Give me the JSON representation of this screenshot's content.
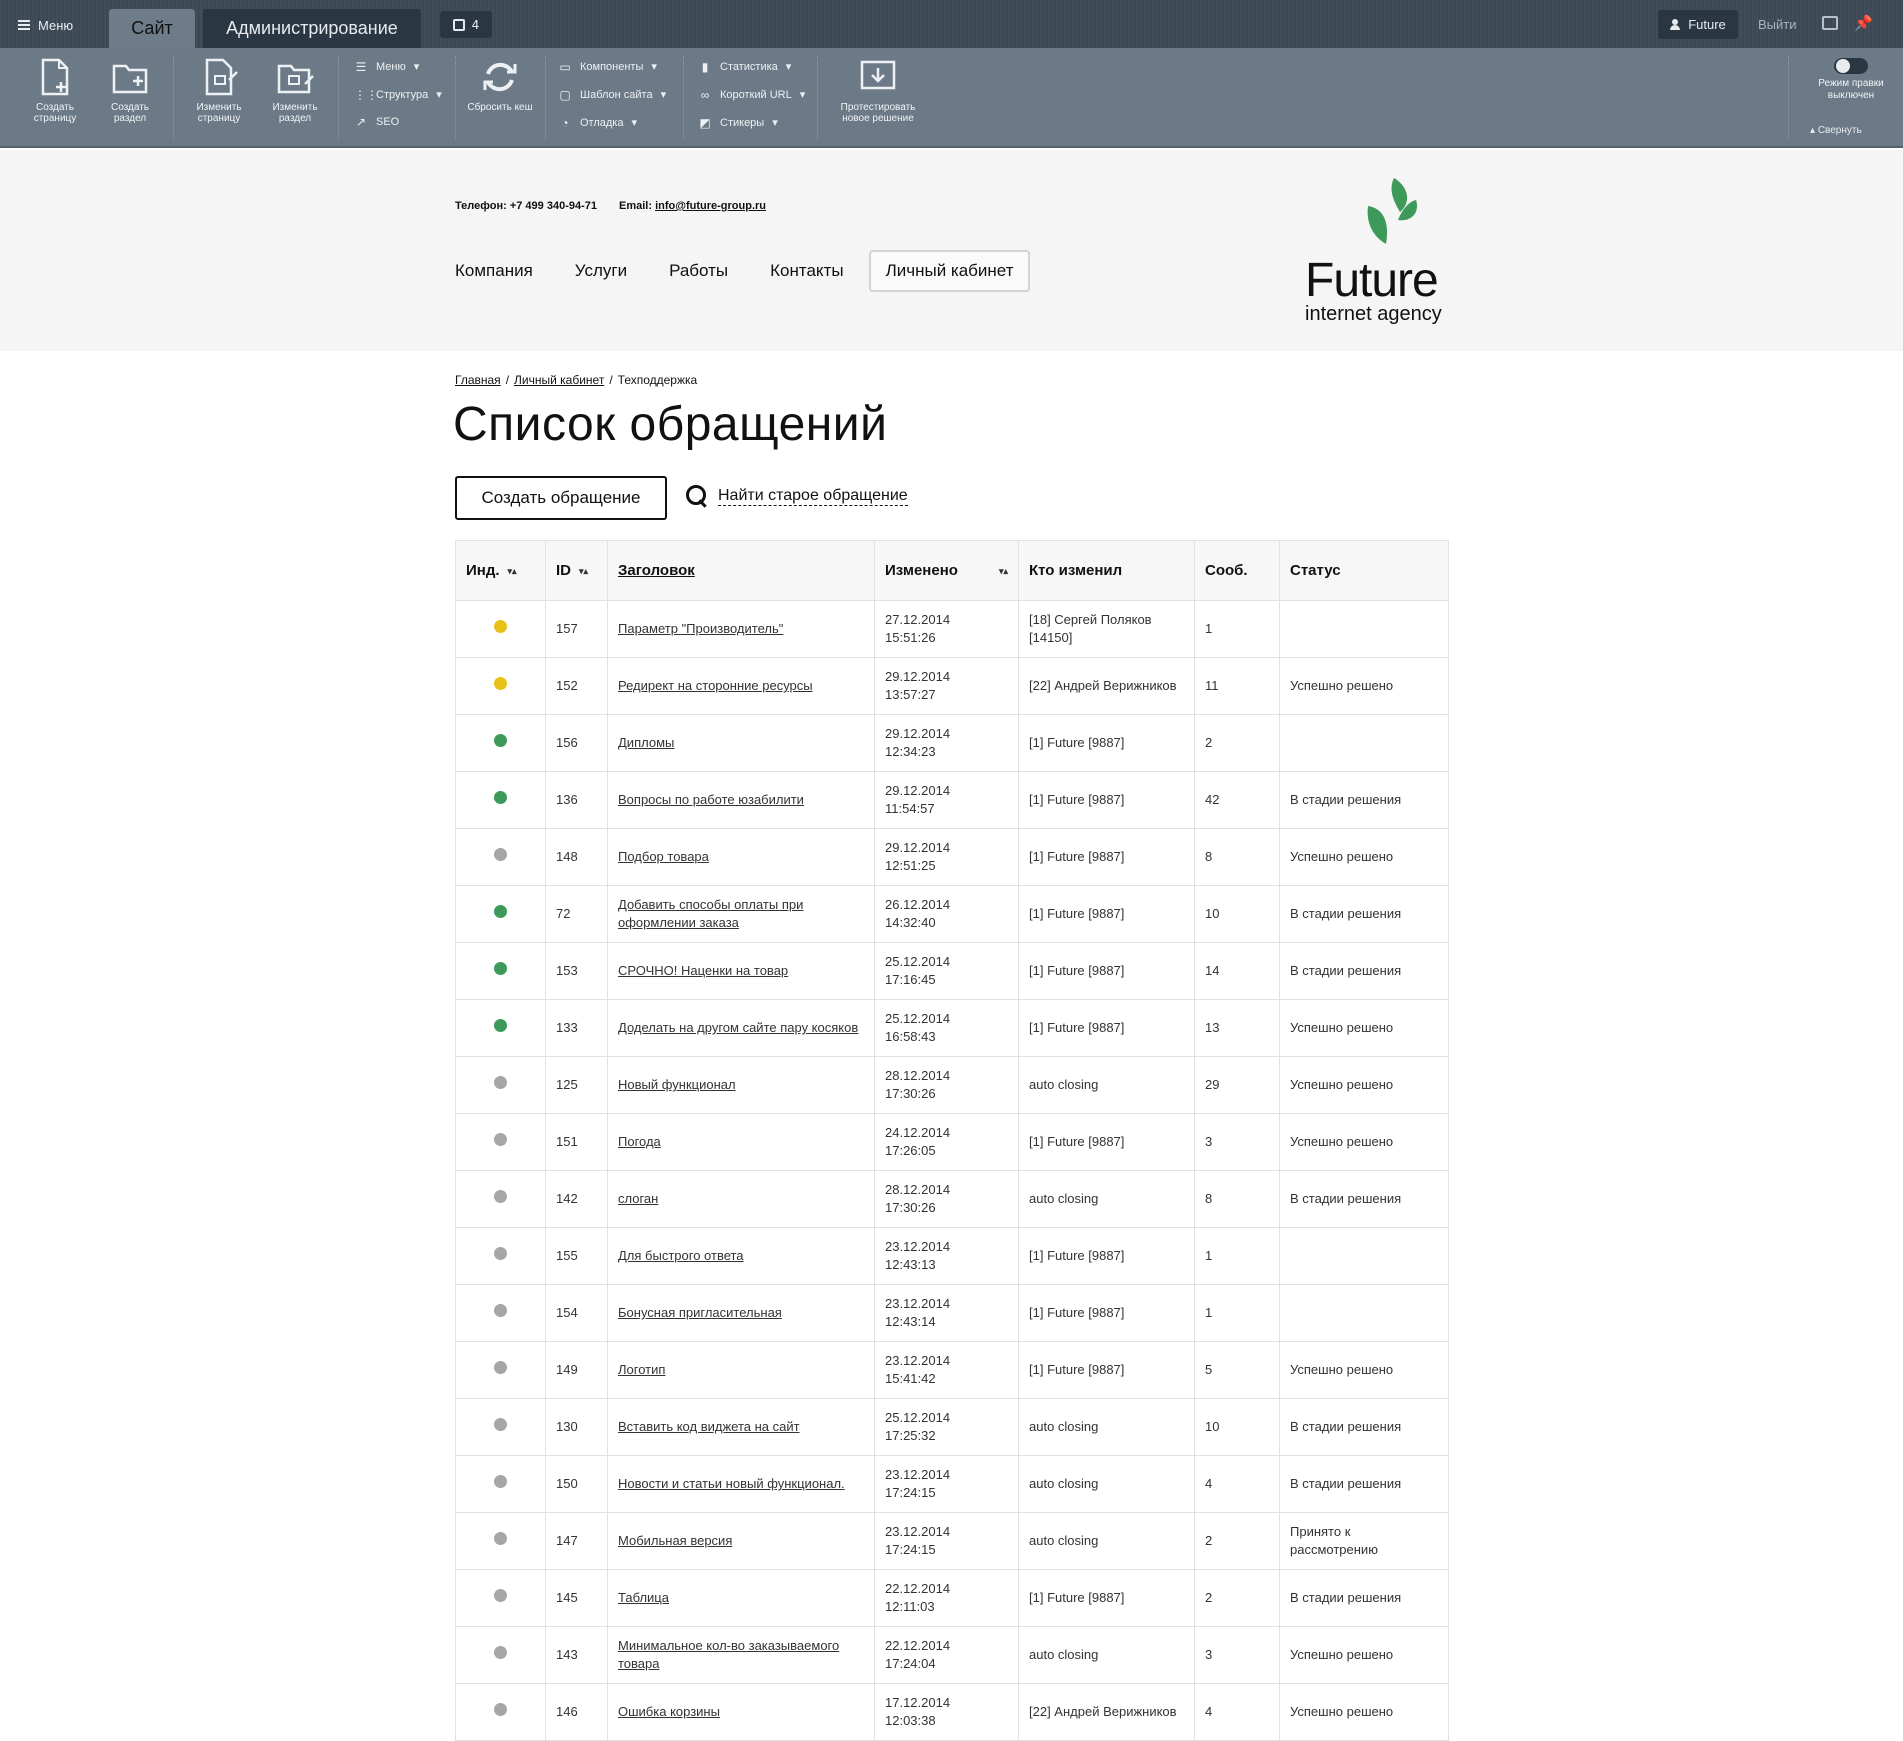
{
  "admin": {
    "menu_label": "Меню",
    "tab_site": "Сайт",
    "tab_admin": "Администрирование",
    "notifications_count": "4",
    "user_label": "Future",
    "logout_label": "Выйти",
    "tools": {
      "create_page": "Создать страницу",
      "create_section": "Создать раздел",
      "edit_page": "Изменить страницу",
      "edit_section": "Изменить раздел",
      "menu": "Меню",
      "structure": "Структура",
      "seo": "SEO",
      "reset_cache": "Сбросить кеш",
      "components": "Компоненты",
      "site_template": "Шаблон сайта",
      "debug": "Отладка",
      "statistics": "Статистика",
      "short_url": "Короткий URL",
      "stickers": "Стикеры",
      "test_solution": "Протестировать новое решение",
      "edit_mode": "Режим правки выключен",
      "collapse": "Свернуть"
    }
  },
  "header": {
    "phone_label": "Телефон:",
    "phone": "+7 499 340-94-71",
    "email_label": "Email:",
    "email": "info@future-group.ru",
    "nav": [
      "Компания",
      "Услуги",
      "Работы",
      "Контакты"
    ],
    "nav_cabinet": "Личный кабинет",
    "logo_title": "Future",
    "logo_subtitle": "internet agency"
  },
  "breadcrumbs": {
    "home": "Главная",
    "cabinet": "Личный кабинет",
    "current": "Техподдержка"
  },
  "page_title": "Список обращений",
  "create_button": "Создать обращение",
  "find_link": "Найти старое обращение",
  "colors": {
    "yellow": "#e8c21a",
    "green": "#3e9a5a",
    "grey": "#a6a6a6"
  },
  "table": {
    "headers": {
      "ind": "Инд.",
      "id": "ID",
      "title": "Заголовок",
      "changed": "Изменено",
      "who": "Кто изменил",
      "msgs": "Сооб.",
      "status": "Статус"
    },
    "rows": [
      {
        "ind": "yellow",
        "id": "157",
        "title": "Параметр \"Производитель\"",
        "date": "27.12.2014",
        "time": "15:51:26",
        "who": "[18] Сергей Поляков [14150]",
        "msgs": "1",
        "status": ""
      },
      {
        "ind": "yellow",
        "id": "152",
        "title": "Редирект на сторонние ресурсы",
        "date": "29.12.2014",
        "time": "13:57:27",
        "who": "[22] Андрей Верижников",
        "msgs": "11",
        "status": "Успешно решено"
      },
      {
        "ind": "green",
        "id": "156",
        "title": "Дипломы",
        "date": "29.12.2014",
        "time": "12:34:23",
        "who": "[1] Future [9887]",
        "msgs": "2",
        "status": ""
      },
      {
        "ind": "green",
        "id": "136",
        "title": "Вопросы по работе юзабилити",
        "date": "29.12.2014",
        "time": "11:54:57",
        "who": "[1] Future [9887]",
        "msgs": "42",
        "status": "В стадии решения"
      },
      {
        "ind": "grey",
        "id": "148",
        "title": "Подбор товара",
        "date": "29.12.2014",
        "time": "12:51:25",
        "who": "[1] Future [9887]",
        "msgs": "8",
        "status": "Успешно решено"
      },
      {
        "ind": "green",
        "id": "72",
        "title": "Добавить способы оплаты при оформлении заказа",
        "date": "26.12.2014",
        "time": "14:32:40",
        "who": "[1] Future [9887]",
        "msgs": "10",
        "status": "В стадии решения"
      },
      {
        "ind": "green",
        "id": "153",
        "title": "СРОЧНО! Наценки на товар",
        "date": "25.12.2014",
        "time": "17:16:45",
        "who": "[1] Future [9887]",
        "msgs": "14",
        "status": "В стадии решения"
      },
      {
        "ind": "green",
        "id": "133",
        "title": "Доделать на другом сайте пару косяков",
        "date": "25.12.2014",
        "time": "16:58:43",
        "who": "[1] Future [9887]",
        "msgs": "13",
        "status": "Успешно решено"
      },
      {
        "ind": "grey",
        "id": "125",
        "title": "Новый функционал",
        "date": "28.12.2014",
        "time": "17:30:26",
        "who": "auto closing",
        "msgs": "29",
        "status": "Успешно решено"
      },
      {
        "ind": "grey",
        "id": "151",
        "title": "Погода",
        "date": "24.12.2014",
        "time": "17:26:05",
        "who": "[1] Future [9887]",
        "msgs": "3",
        "status": "Успешно решено"
      },
      {
        "ind": "grey",
        "id": "142",
        "title": "слоган",
        "date": "28.12.2014",
        "time": "17:30:26",
        "who": "auto closing",
        "msgs": "8",
        "status": "В стадии решения"
      },
      {
        "ind": "grey",
        "id": "155",
        "title": "Для быстрого ответа",
        "date": "23.12.2014",
        "time": "12:43:13",
        "who": "[1] Future [9887]",
        "msgs": "1",
        "status": ""
      },
      {
        "ind": "grey",
        "id": "154",
        "title": "Бонусная пригласительная",
        "date": "23.12.2014",
        "time": "12:43:14",
        "who": "[1] Future [9887]",
        "msgs": "1",
        "status": ""
      },
      {
        "ind": "grey",
        "id": "149",
        "title": "Логотип",
        "date": "23.12.2014",
        "time": "15:41:42",
        "who": "[1] Future [9887]",
        "msgs": "5",
        "status": "Успешно решено"
      },
      {
        "ind": "grey",
        "id": "130",
        "title": "Вставить код виджета на сайт",
        "date": "25.12.2014",
        "time": "17:25:32",
        "who": "auto closing",
        "msgs": "10",
        "status": "В стадии решения"
      },
      {
        "ind": "grey",
        "id": "150",
        "title": "Новости и статьи новый функционал.",
        "date": "23.12.2014",
        "time": "17:24:15",
        "who": "auto closing",
        "msgs": "4",
        "status": "В стадии решения"
      },
      {
        "ind": "grey",
        "id": "147",
        "title": "Мобильная версия",
        "date": "23.12.2014",
        "time": "17:24:15",
        "who": "auto closing",
        "msgs": "2",
        "status": "Принято к рассмотрению"
      },
      {
        "ind": "grey",
        "id": "145",
        "title": "Таблица",
        "date": "22.12.2014",
        "time": "12:11:03",
        "who": "[1] Future [9887]",
        "msgs": "2",
        "status": "В стадии решения"
      },
      {
        "ind": "grey",
        "id": "143",
        "title": "Минимальное кол-во заказываемого товара",
        "date": "22.12.2014",
        "time": "17:24:04",
        "who": "auto closing",
        "msgs": "3",
        "status": "Успешно решено"
      },
      {
        "ind": "grey",
        "id": "146",
        "title": "Ошибка корзины",
        "date": "17.12.2014",
        "time": "12:03:38",
        "who": "[22] Андрей Верижников",
        "msgs": "4",
        "status": "Успешно решено"
      }
    ]
  }
}
